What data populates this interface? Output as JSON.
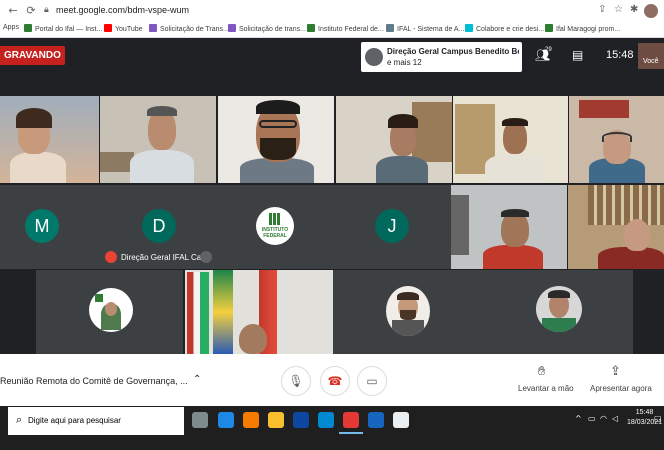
{
  "browser": {
    "url": "meet.google.com/bdm-vspe-wum",
    "bookmarks": [
      {
        "label": "Apps",
        "color": "#4285f4"
      },
      {
        "label": "Portal do Ifal — Inst...",
        "color": "#2e7d32"
      },
      {
        "label": "YouTube",
        "color": "#ff0000"
      },
      {
        "label": "Solicitação de Trans...",
        "color": "#7e57c2"
      },
      {
        "label": "Solicitação de trans...",
        "color": "#7e57c2"
      },
      {
        "label": "Instituto Federal de...",
        "color": "#2e7d32"
      },
      {
        "label": "IFAL - Sistema de A...",
        "color": "#607d8b"
      },
      {
        "label": "Colabore e crie desi...",
        "color": "#00bcd4"
      },
      {
        "label": "Ifal Maragogi prom...",
        "color": "#2e7d32"
      }
    ]
  },
  "meet": {
    "recording_label": "GRAVANDO",
    "presenter_line1": "Direção Geral Campus Benedito Be...",
    "presenter_line2": "e mais 12",
    "participant_count": "29",
    "clock": "15:48",
    "self_label": "Você",
    "tiles": {
      "m_letter": "M",
      "d_letter": "D",
      "d_name": "Direção Geral IFAL Ca...",
      "logo_text": "INSTITUTO FEDERAL",
      "j_letter": "J"
    },
    "colors": {
      "recording": "#c5221f",
      "avatar_m": "#00796b",
      "avatar_d": "#00695c",
      "avatar_j": "#00695c",
      "end_call": "#d93025"
    },
    "meeting_title": "Reunião Remota do Comitê de Governança, ...",
    "controls": {
      "mic_icon": "mic-icon",
      "end_icon": "end-call-icon",
      "camera_icon": "camera-icon",
      "raise_hand": "Levantar a mão",
      "present_now": "Apresentar agora"
    }
  },
  "taskbar": {
    "search_placeholder": "Digite aqui para pesquisar",
    "time": "15:48",
    "date": "18/03/2021"
  }
}
